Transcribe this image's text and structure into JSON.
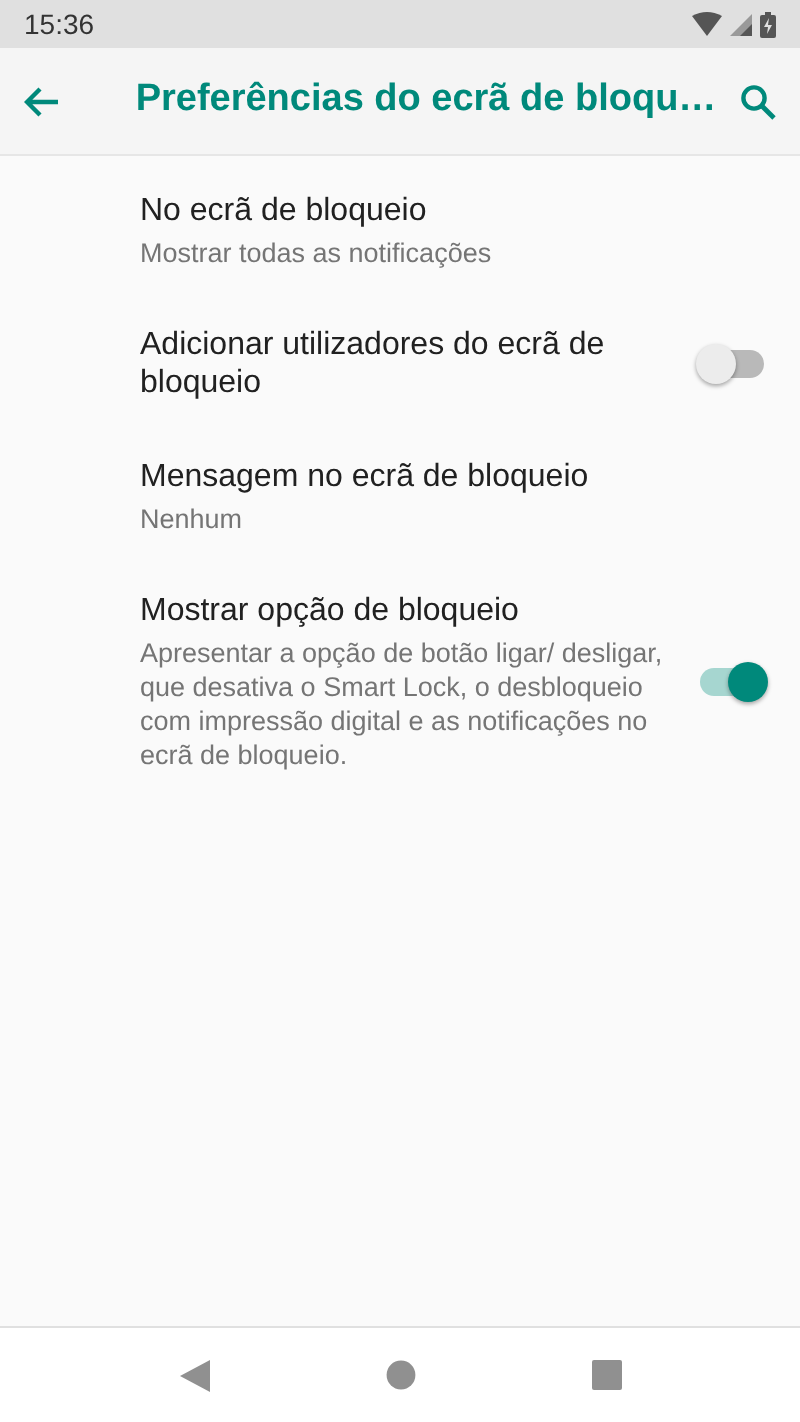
{
  "status_bar": {
    "time": "15:36"
  },
  "app_bar": {
    "title": "Preferências do ecrã de bloqu…"
  },
  "preferences": [
    {
      "kind": "text",
      "title": "No ecrã de bloqueio",
      "summary": "Mostrar todas as notificações"
    },
    {
      "kind": "switch",
      "title": "Adicionar utilizadores do ecrã de bloqueio",
      "on": false
    },
    {
      "kind": "text",
      "title": "Mensagem no ecrã de bloqueio",
      "summary": "Nenhum"
    },
    {
      "kind": "switch",
      "title": "Mostrar opção de bloqueio",
      "summary": "Apresentar a opção de botão ligar/ desligar, que desativa o Smart Lock, o desbloqueio com impressão digital e as notificações no ecrã de bloqueio.",
      "on": true
    }
  ]
}
